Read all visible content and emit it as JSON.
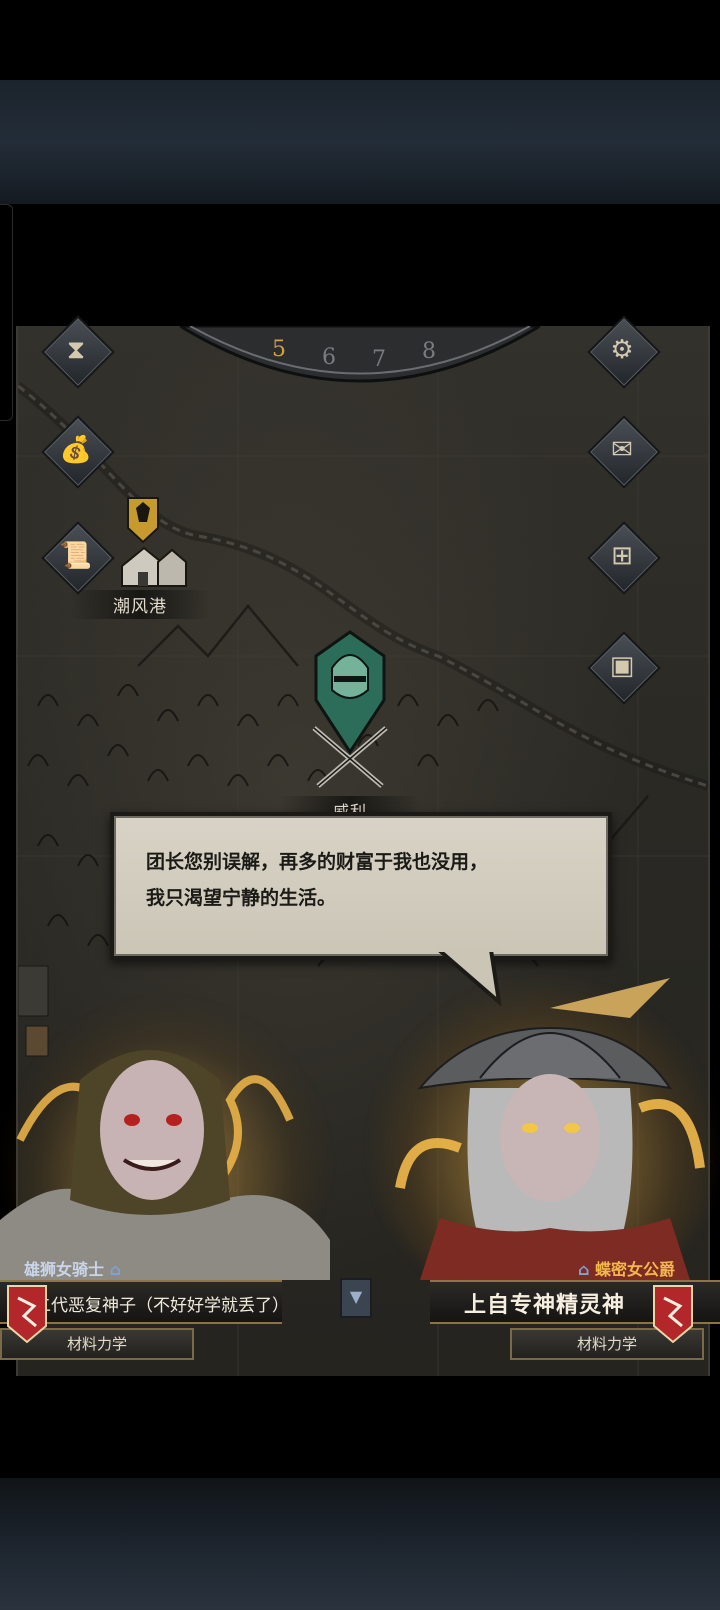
{
  "map": {
    "dial_numbers": [
      "5",
      "6",
      "7",
      "8"
    ],
    "locations": [
      {
        "name": "潮风港"
      },
      {
        "name": "威利"
      }
    ]
  },
  "side_buttons": {
    "left": [
      "hourglass-icon",
      "money-bag-icon",
      "scroll-icon"
    ],
    "right": [
      "gear-icon",
      "mail-icon",
      "board-icon",
      "supplies-icon"
    ]
  },
  "dialog": {
    "line1": "团长您别误解，再多的财富于我也没用，",
    "line2": "我只渴望宁静的生活。"
  },
  "left_character": {
    "rank": "雄狮女骑士",
    "name": "二代恶复神子（不好好学就丢了）",
    "major": "材料力学"
  },
  "right_character": {
    "rank": "蝶密女公爵",
    "name": "上自专神精灵神",
    "major": "材料力学"
  },
  "colors": {
    "accent_gold": "#f2b94a",
    "crest_red": "#b3262a",
    "dialog_paper": "#d0cabb"
  }
}
